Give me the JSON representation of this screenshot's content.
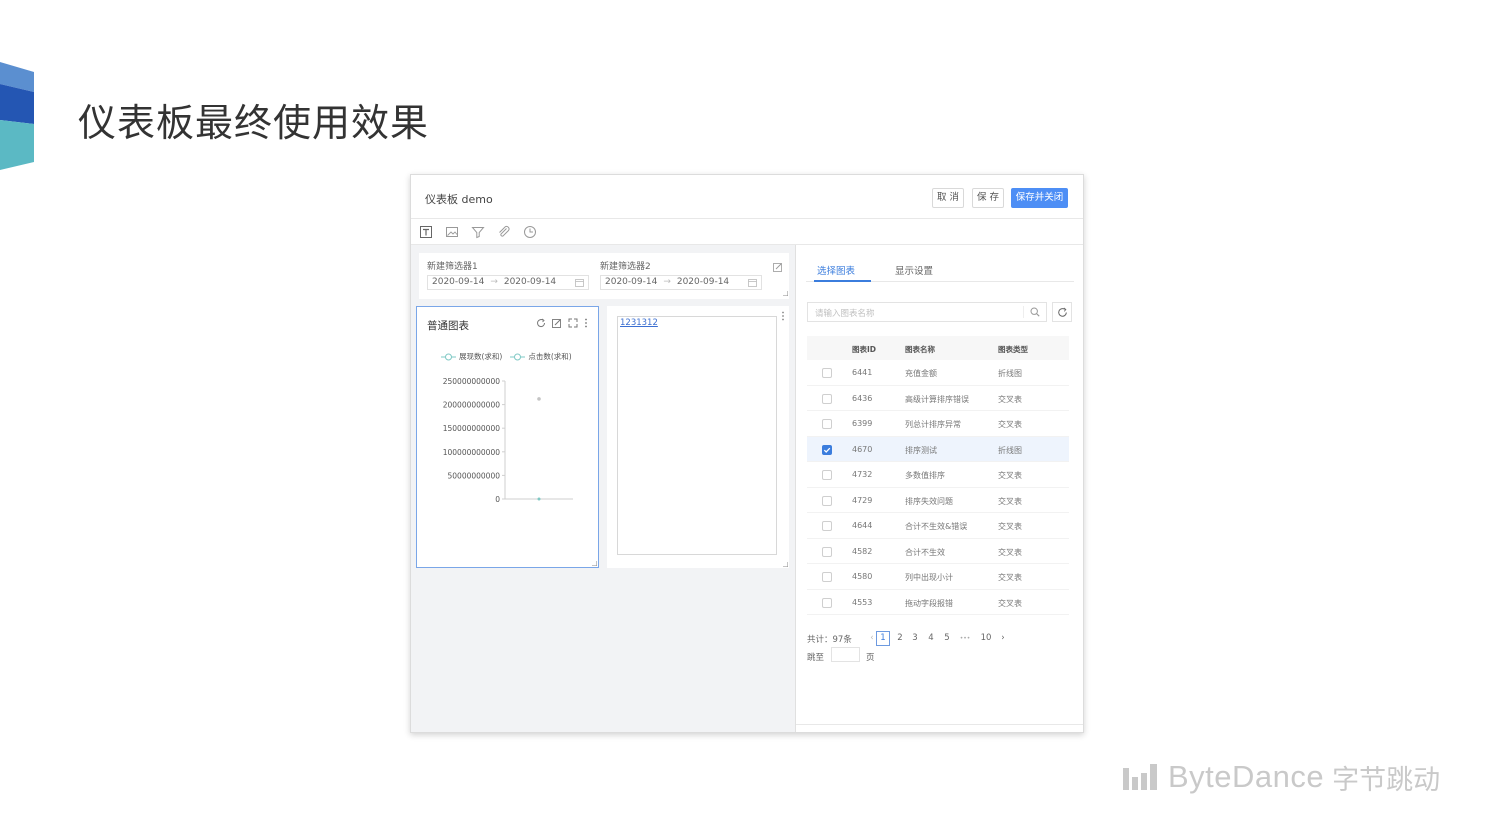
{
  "slide": {
    "title": "仪表板最终使用效果",
    "brand_name": "ByteDance",
    "brand_cn": "字节跳动"
  },
  "app": {
    "title": "仪表板 demo",
    "buttons": {
      "cancel": "取 消",
      "save": "保 存",
      "save_close": "保存并关闭"
    },
    "toolbar_icons": [
      "text-icon",
      "image-icon",
      "filter-icon",
      "attachment-icon",
      "clock-icon"
    ]
  },
  "filters": [
    {
      "label": "新建筛选器1",
      "start": "2020-09-14",
      "end": "2020-09-14"
    },
    {
      "label": "新建筛选器2",
      "start": "2020-09-14",
      "end": "2020-09-14"
    }
  ],
  "chart_card": {
    "title": "普通图表",
    "legend": [
      "展现数(求和)",
      "点击数(求和)"
    ]
  },
  "chart_data": {
    "type": "scatter",
    "title": "普通图表",
    "ylim": [
      0,
      250000000000
    ],
    "yticks": [
      "250000000000",
      "200000000000",
      "150000000000",
      "100000000000",
      "50000000000",
      "0"
    ],
    "series": [
      {
        "name": "展现数(求和)",
        "values": [
          212000000000
        ],
        "color": "#c4c4c4"
      },
      {
        "name": "点击数(求和)",
        "values": [
          0
        ],
        "color": "#7ec8c4"
      }
    ]
  },
  "text_card": {
    "link": "1231312"
  },
  "panel": {
    "tabs": [
      "选择图表",
      "显示设置"
    ],
    "search_placeholder": "请输入图表名称",
    "columns": [
      "图表ID",
      "图表名称",
      "图表类型"
    ],
    "rows": [
      {
        "id": "6441",
        "name": "充值金额",
        "type": "折线图",
        "checked": false
      },
      {
        "id": "6436",
        "name": "高级计算排序错误",
        "type": "交叉表",
        "checked": false
      },
      {
        "id": "6399",
        "name": "列总计排序异常",
        "type": "交叉表",
        "checked": false
      },
      {
        "id": "4670",
        "name": "排序测试",
        "type": "折线图",
        "checked": true
      },
      {
        "id": "4732",
        "name": "多数值排序",
        "type": "交叉表",
        "checked": false
      },
      {
        "id": "4729",
        "name": "排序失效问题",
        "type": "交叉表",
        "checked": false
      },
      {
        "id": "4644",
        "name": "合计不生效&错误",
        "type": "交叉表",
        "checked": false
      },
      {
        "id": "4582",
        "name": "合计不生效",
        "type": "交叉表",
        "checked": false
      },
      {
        "id": "4580",
        "name": "列中出现小计",
        "type": "交叉表",
        "checked": false
      },
      {
        "id": "4553",
        "name": "拖动字段报错",
        "type": "交叉表",
        "checked": false
      }
    ],
    "pagination": {
      "total": "共计：97条",
      "prev": "‹",
      "pages": [
        "1",
        "2",
        "3",
        "4",
        "5"
      ],
      "ellipsis": "•••",
      "last": "10",
      "next": "›",
      "current": "1",
      "jump_label": "跳至",
      "jump_unit": "页"
    }
  }
}
